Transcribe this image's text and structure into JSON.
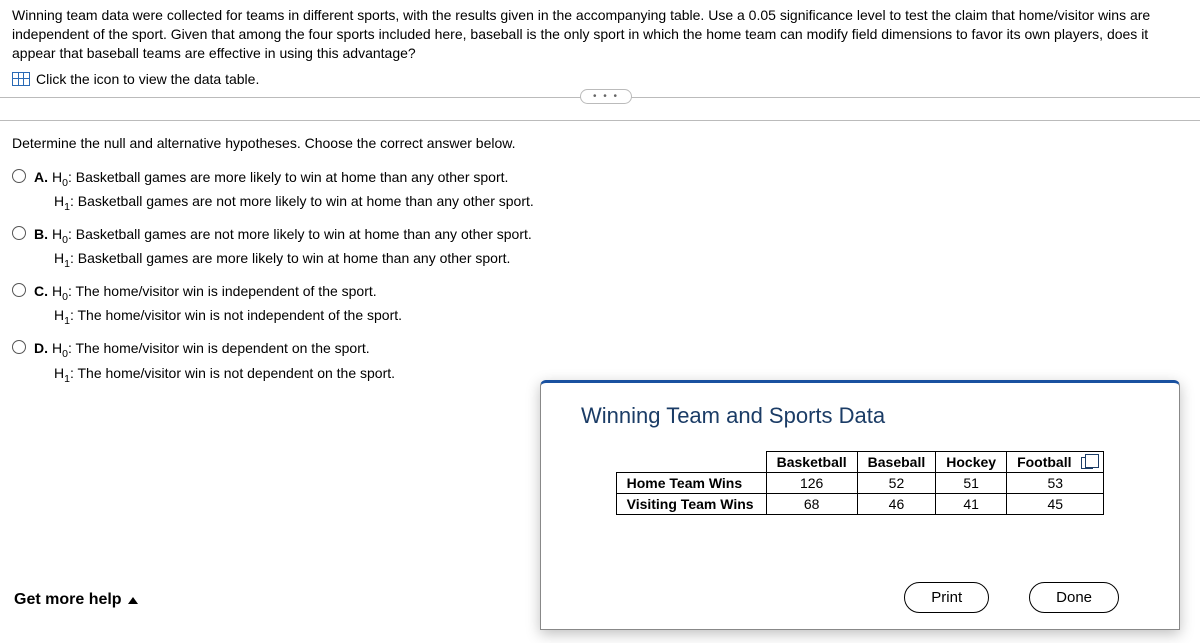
{
  "question": {
    "intro": "Winning team data were collected for teams in different sports, with the results given in the accompanying table. Use a 0.05 significance level to test the claim that home/visitor wins are independent of the sport. Given that among the four sports included here, baseball is the only sport in which the home team can modify field dimensions to favor its own players, does it appear that baseball teams are effective in using this advantage?",
    "icon_link_text": "Click the icon to view the data table.",
    "prompt": "Determine the null and alternative hypotheses. Choose the correct answer below."
  },
  "options": {
    "A": {
      "h0": "Basketball games are more likely to win at home than any other sport.",
      "h1": "Basketball games are not more likely to win at home than any other sport."
    },
    "B": {
      "h0": "Basketball games are not more likely to win at home than any other sport.",
      "h1": "Basketball games are more likely to win at home than any other sport."
    },
    "C": {
      "h0": "The home/visitor win is independent of the sport.",
      "h1": "The home/visitor win is not independent of the sport."
    },
    "D": {
      "h0": "The home/visitor win is dependent on the sport.",
      "h1": "The home/visitor win is not dependent on the sport."
    }
  },
  "get_help": "Get more help",
  "popup": {
    "title": "Winning Team and Sports Data",
    "print": "Print",
    "done": "Done"
  },
  "chart_data": {
    "type": "table",
    "columns": [
      "Basketball",
      "Baseball",
      "Hockey",
      "Football"
    ],
    "rows": [
      {
        "label": "Home Team Wins",
        "values": [
          126,
          52,
          51,
          53
        ]
      },
      {
        "label": "Visiting Team Wins",
        "values": [
          68,
          46,
          41,
          45
        ]
      }
    ]
  }
}
